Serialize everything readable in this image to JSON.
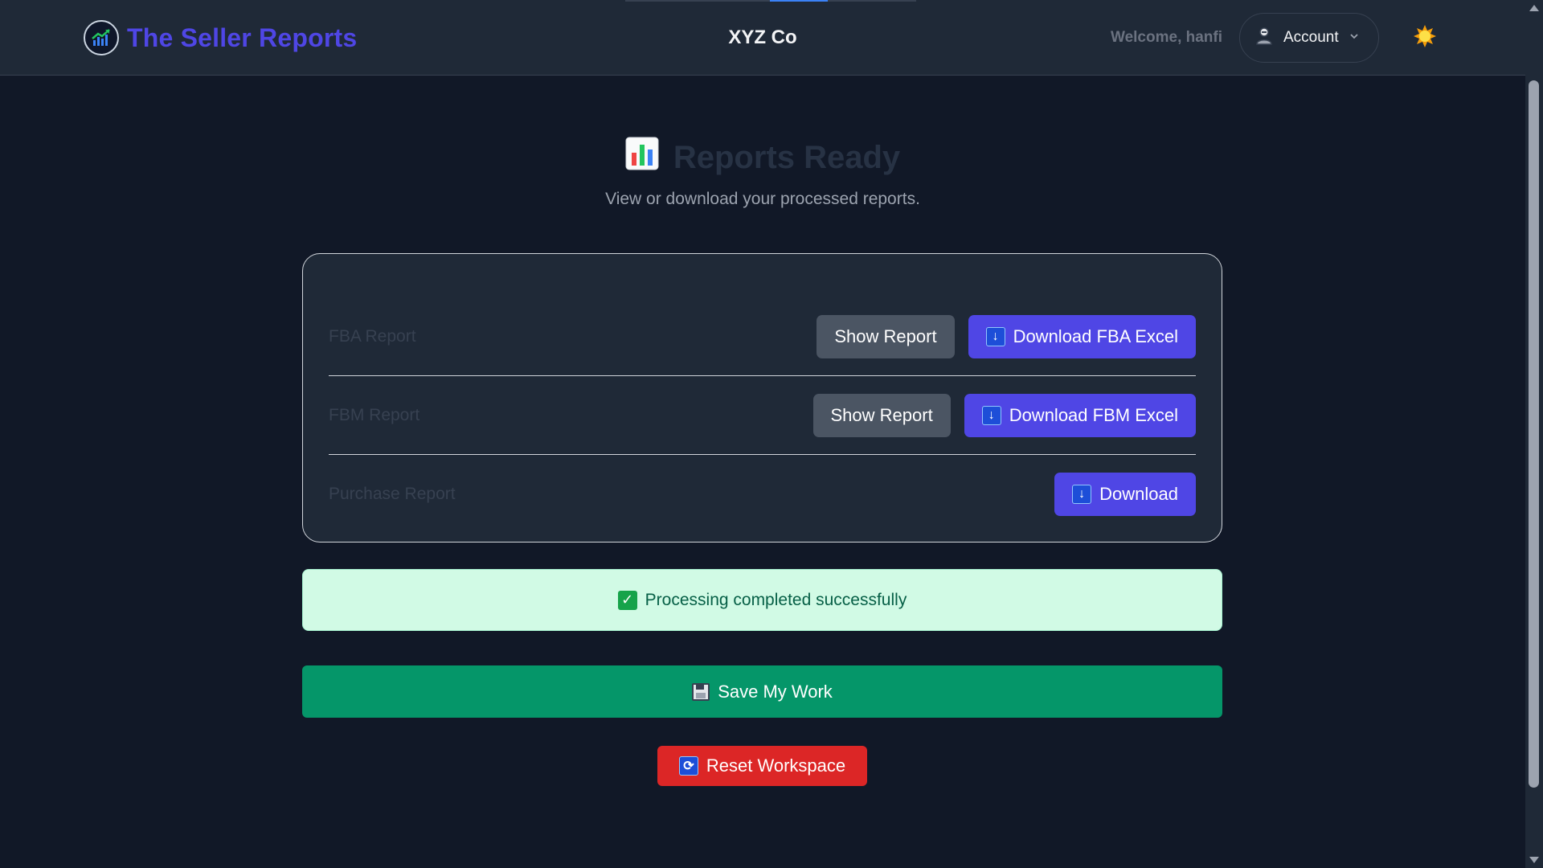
{
  "header": {
    "brand_title": "The Seller Reports",
    "company_name": "XYZ Co",
    "welcome_text": "Welcome, hanfi",
    "account_label": "Account",
    "icons": {
      "logo": "growth-chart-icon",
      "account": "user-icon",
      "chevron": "chevron-down-icon",
      "theme": "sun-icon"
    }
  },
  "hero": {
    "title": "Reports Ready",
    "subtitle": "View or download your processed reports.",
    "icon": "bar-chart-icon"
  },
  "reports": [
    {
      "label": "FBA Report",
      "show_label": "Show Report",
      "download_label": "Download FBA Excel"
    },
    {
      "label": "FBM Report",
      "show_label": "Show Report",
      "download_label": "Download FBM Excel"
    },
    {
      "label": "Purchase Report",
      "download_label": "Download"
    }
  ],
  "status": {
    "message": "Processing completed successfully",
    "icon": "check-icon"
  },
  "actions": {
    "save_label": "Save My Work",
    "reset_label": "Reset Workspace"
  },
  "colors": {
    "background": "#111827",
    "header": "#1f2937",
    "brand": "#4f46e5",
    "primary_button": "#4f46e5",
    "secondary_button": "#4b5563",
    "success_bg": "#d1fae5",
    "save_button": "#059669",
    "reset_button": "#dc2626"
  }
}
